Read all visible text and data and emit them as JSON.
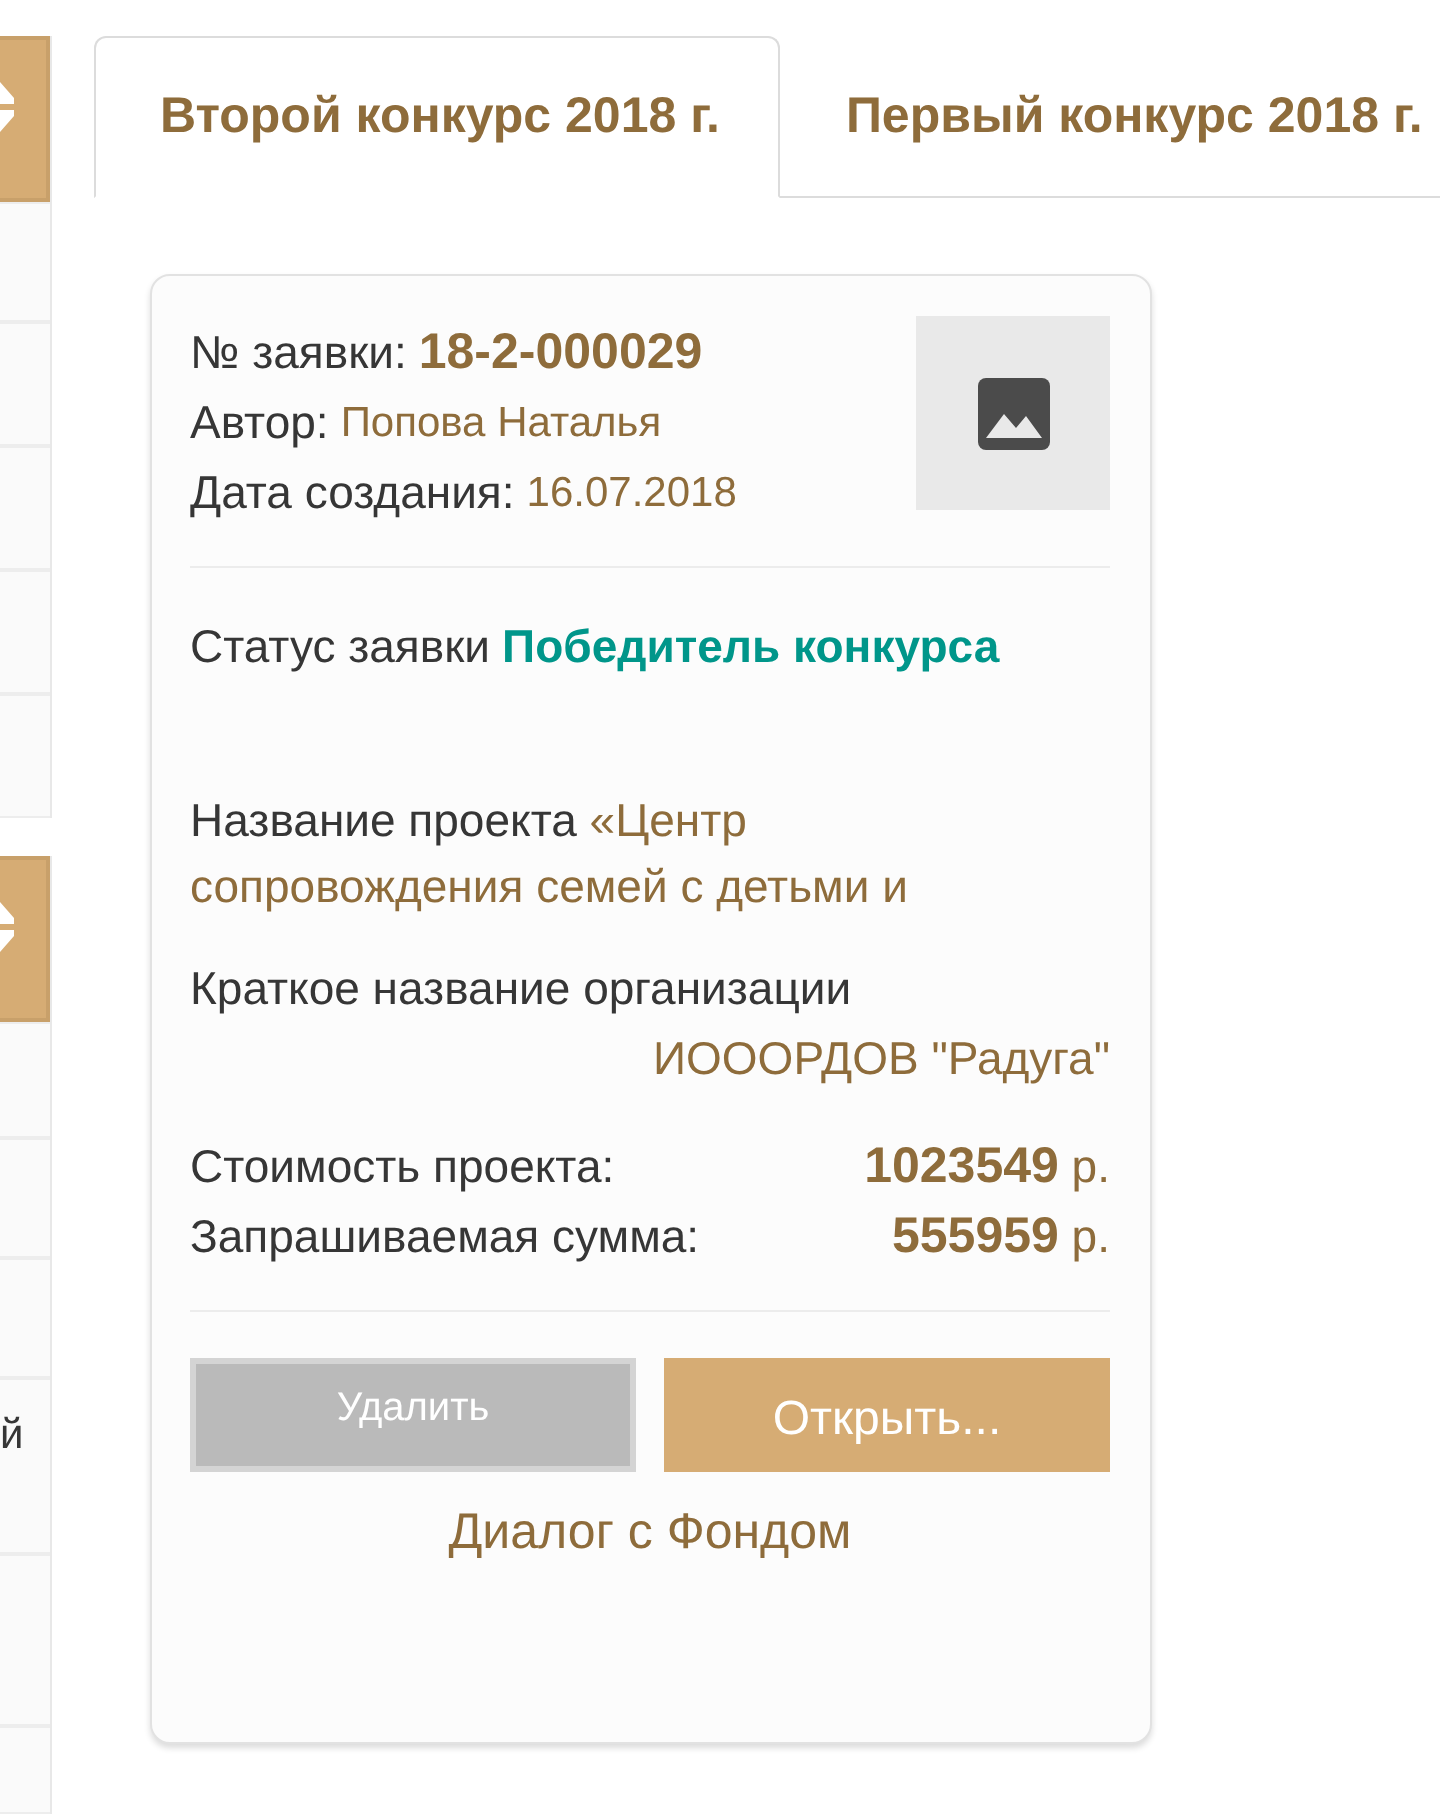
{
  "sidebar": {
    "row_text": "й"
  },
  "tabs": [
    {
      "label": "Второй конкурс 2018 г.",
      "selected": true
    },
    {
      "label": "Первый конкурс 2018 г.",
      "selected": false
    }
  ],
  "application": {
    "number": {
      "label": "№ заявки:",
      "value": "18-2-000029"
    },
    "author": {
      "label": "Автор:",
      "value": "Попова Наталья"
    },
    "created": {
      "label": "Дата создания:",
      "value": "16.07.2018"
    },
    "status": {
      "label": "Статус заявки",
      "value": "Победитель конкурса"
    },
    "project_name": {
      "label": "Название проекта",
      "value": "«Центр сопровождения семей с детьми и"
    },
    "organization": {
      "label": "Краткое название организации",
      "value": "ИОООРДОВ \"Радуга\""
    },
    "amounts": [
      {
        "label": "Стоимость проекта:",
        "value": "**1023549** р."
      },
      {
        "label": "Запрашиваемая сумма:",
        "value": "**555959** р."
      }
    ]
  },
  "buttons": [
    {
      "label": "Удалить",
      "disabled": true
    },
    {
      "label": "Открыть...",
      "disabled": false
    }
  ],
  "link": "Диалог с Фондом"
}
